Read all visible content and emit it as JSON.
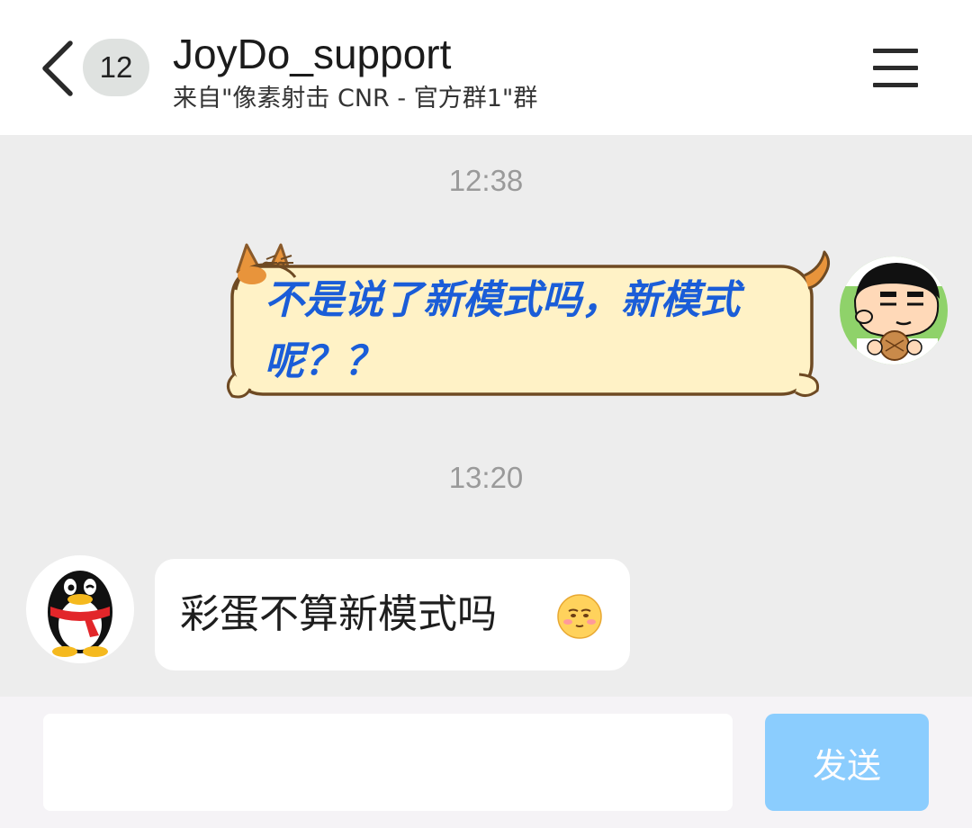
{
  "header": {
    "back_icon": "chevron-left-icon",
    "unread_count": "12",
    "title": "JoyDo_support",
    "subtitle": "来自\"像素射击 CNR - 官方群1\"群",
    "menu_icon": "hamburger-menu-icon"
  },
  "chat": {
    "messages": [
      {
        "time": "12:38",
        "sender": "self",
        "text": "不是说了新模式吗，新模式呢？？",
        "bubble_style": "cat-themed bubble",
        "text_color": "#1a5dd8",
        "bubble_color": "#fff2c6"
      },
      {
        "time": "13:20",
        "sender": "other",
        "text": "彩蛋不算新模式吗",
        "emoji": "blushing-face-emoji",
        "bubble_color": "#ffffff"
      }
    ]
  },
  "input": {
    "value": "",
    "send_label": "发送",
    "send_color": "#80c9ff"
  }
}
